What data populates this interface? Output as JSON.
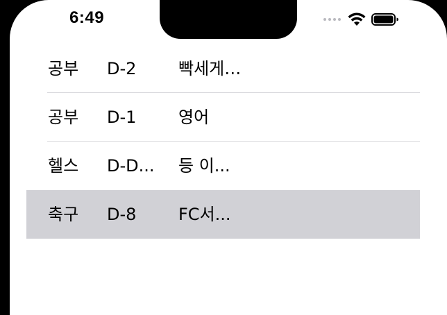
{
  "status_bar": {
    "time": "6:49",
    "icons": [
      "cellular-dots-icon",
      "wifi-icon",
      "battery-icon"
    ]
  },
  "list": {
    "rows": [
      {
        "category": "공부",
        "dday": "D-2",
        "title": "빡세게…",
        "selected": false
      },
      {
        "category": "공부",
        "dday": "D-1",
        "title": "영어",
        "selected": false
      },
      {
        "category": "헬스",
        "dday": "D-D...",
        "title": "등 이...",
        "selected": false
      },
      {
        "category": "축구",
        "dday": "D-8",
        "title": "FC서...",
        "selected": true
      }
    ]
  },
  "colors": {
    "selected_row": "#d1d1d6",
    "separator": "#d8d8dc",
    "bezel": "#000000"
  }
}
